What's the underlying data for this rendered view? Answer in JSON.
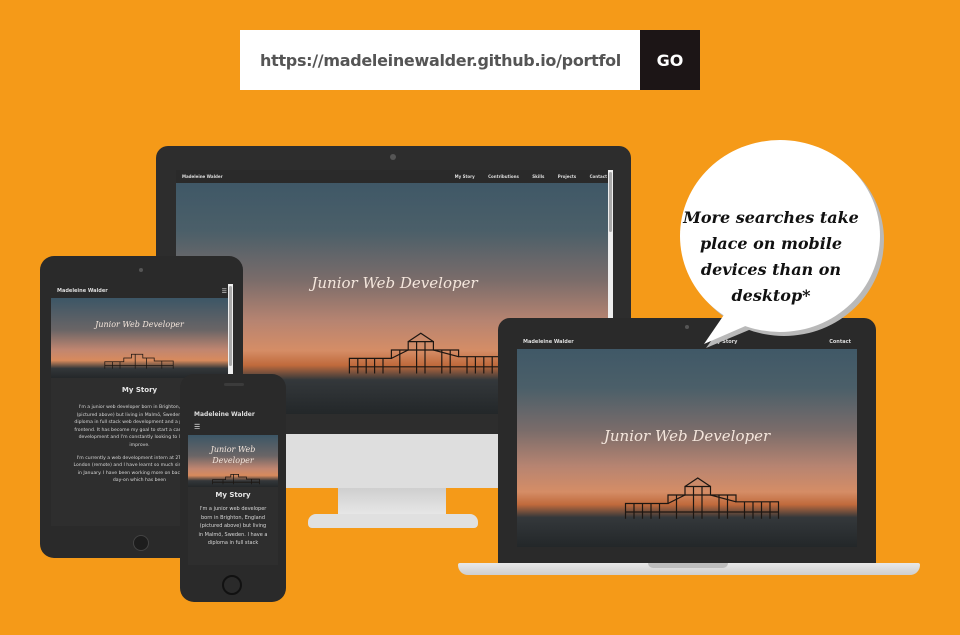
{
  "urlbar": {
    "value": "https://madeleinewalder.github.io/portfolio/",
    "go_label": "GO"
  },
  "site": {
    "brand": "Madeleine Walder",
    "nav": [
      "My Story",
      "Contributions",
      "Skills",
      "Projects",
      "Contact"
    ],
    "hero_title": "Junior Web Developer",
    "story_heading": "My Story",
    "story_tablet_p1": "I'm a junior web developer born in Brighton, England (pictured above) but living in Malmö, Sweden. I have a diploma in full stack web development and a passion for frontend. It has become my goal to start a career in web development and I'm constantly looking to learn and improve.",
    "story_tablet_p2": "I'm currently a web development intern at 2Toucans in London (remote) and I have learnt so much since I began in January. I have been working more on backend and day-on which has been",
    "story_phone_p1": "I'm a junior web developer born in Brighton, England (pictured above) but living in Malmö, Sweden. I have a diploma in full stack"
  },
  "bubble": {
    "text": "More searches take place on mobile devices than on desktop*"
  },
  "colors": {
    "background": "#f59a18",
    "go_button": "#1c1516",
    "device_frame": "#2a2a2a"
  },
  "icons": {
    "menu": "hamburger-menu-icon",
    "camera": "camera-dot-icon",
    "home": "home-button-icon"
  }
}
